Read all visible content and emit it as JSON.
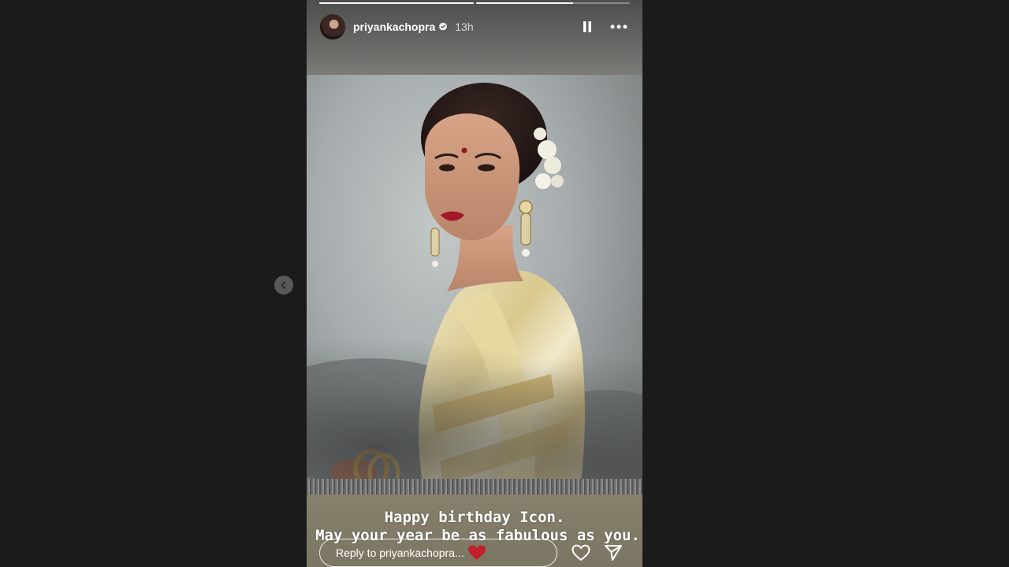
{
  "story": {
    "username": "priyankachopra",
    "time_ago": "13h",
    "progress": [
      1.0,
      0.63
    ],
    "caption_line1": "Happy birthday Icon.",
    "caption_line2": "May your year be as fabulous as you.",
    "reply_placeholder": "Reply to priyankachopra..."
  },
  "icons": {
    "verified": "verified-badge-icon",
    "pause": "pause-icon",
    "more": "more-options-icon",
    "prev": "chevron-left-icon",
    "like": "heart-icon",
    "share": "paper-plane-icon",
    "caption_emoji": "red-heart-emoji"
  },
  "colors": {
    "page_background": "#1b1b1b",
    "verified_badge": "#3897f0",
    "heart_emoji": "#c21f2a"
  }
}
